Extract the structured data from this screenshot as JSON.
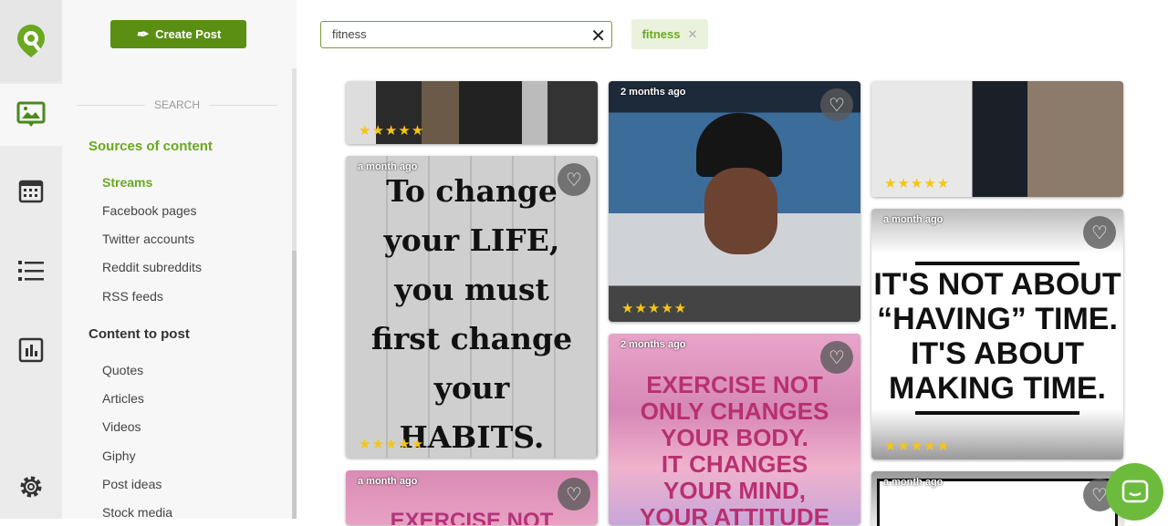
{
  "sidebar": {
    "create_post": "Create Post",
    "search_label": "SEARCH",
    "sources_heading": "Sources of content",
    "sources": [
      "Streams",
      "Facebook pages",
      "Twitter accounts",
      "Reddit subreddits",
      "RSS feeds"
    ],
    "content_heading": "Content to post",
    "content": [
      "Quotes",
      "Articles",
      "Videos",
      "Giphy",
      "Post ideas",
      "Stock media"
    ]
  },
  "search": {
    "value": "fitness",
    "tag": "fitness"
  },
  "cards": {
    "c1a": {
      "stars": "★★★★★"
    },
    "c1b": {
      "ago": "a month ago",
      "text": [
        "To change",
        "your LIFE,",
        "you must",
        "first change",
        "your",
        "HABITS."
      ],
      "stars": "★★★★★"
    },
    "c1c": {
      "ago": "a month ago",
      "text": "EXERCISE NOT"
    },
    "c2a": {
      "ago": "2 months ago",
      "stars": "★★★★★"
    },
    "c2b": {
      "ago": "2 months ago",
      "text": [
        "EXERCISE NOT",
        "ONLY CHANGES",
        "YOUR BODY.",
        "IT CHANGES",
        "YOUR MIND,",
        "YOUR ATTITUDE"
      ]
    },
    "c3a": {
      "stars": "★★★★★"
    },
    "c3b": {
      "ago": "a month ago",
      "text": [
        "IT'S NOT ABOUT",
        "“HAVING” TIME.",
        "IT'S ABOUT",
        "MAKING TIME."
      ],
      "stars": "★★★★★"
    },
    "c3c": {
      "ago": "a month ago"
    }
  },
  "colors": {
    "brand": "#5a8f14",
    "accent": "#6aa820",
    "star": "#f5c518"
  }
}
